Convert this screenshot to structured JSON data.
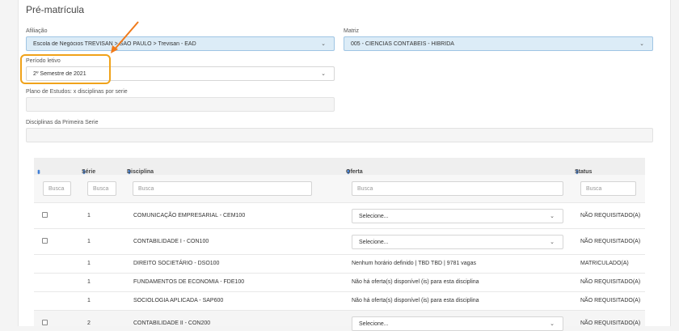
{
  "page_title": "Pré-matrícula",
  "afiliacao": {
    "label": "Afiliação",
    "value": "Escola de Negócios TREVISAN > SÃO PAULO > Trevisan - EAD"
  },
  "matriz": {
    "label": "Matriz",
    "value": "005 - CIÊNCIAS CONTÁBEIS - HÍBRIDA"
  },
  "periodo": {
    "label": "Período letivo",
    "value": "2º Semestre de 2021"
  },
  "plano": {
    "label": "Plano de Estudos: x disciplinas por serie",
    "value": ""
  },
  "disciplinas_label": "Disciplinas da Primeira Serie",
  "colors": {
    "highlight": "#f0a21a",
    "arrow": "#f07a1a",
    "select_blue": "#dcecf7",
    "sort_icon": "#3a7bd5"
  },
  "table": {
    "headers": {
      "serie": "Série",
      "disciplina": "Disciplina",
      "oferta": "Oferta",
      "status": "Status"
    },
    "filter_placeholder": "Busca",
    "rows": [
      {
        "checkbox": true,
        "serie": "1",
        "disciplina": "COMUNICAÇÃO EMPRESARIAL - CEM100",
        "oferta_select": true,
        "oferta": "Selecione...",
        "status": "NÃO REQUISITADO(A)"
      },
      {
        "checkbox": true,
        "serie": "1",
        "disciplina": "CONTABILIDADE I - CON100",
        "oferta_select": true,
        "oferta": "Selecione...",
        "status": "NÃO REQUISITADO(A)"
      },
      {
        "checkbox": false,
        "serie": "1",
        "disciplina": "DIREITO SOCIETÁRIO - DSO100",
        "oferta_select": false,
        "oferta": "Nenhum horário definido | TBD TBD | 9781 vagas",
        "status": "MATRICULADO(A)"
      },
      {
        "checkbox": false,
        "serie": "1",
        "disciplina": "FUNDAMENTOS DE ECONOMIA - FDE100",
        "oferta_select": false,
        "oferta": "Não há oferta(s) disponível (is) para esta disciplina",
        "status": "NÃO REQUISITADO(A)"
      },
      {
        "checkbox": false,
        "serie": "1",
        "disciplina": "SOCIOLOGIA APLICADA - SAP600",
        "oferta_select": false,
        "oferta": "Não há oferta(s) disponível (is) para esta disciplina",
        "status": "NÃO REQUISITADO(A)"
      },
      {
        "checkbox": true,
        "serie": "2",
        "disciplina": "CONTABILIDADE II - CON200",
        "oferta_select": true,
        "oferta": "Selecione...",
        "status": "NÃO REQUISITADO(A)"
      }
    ]
  }
}
